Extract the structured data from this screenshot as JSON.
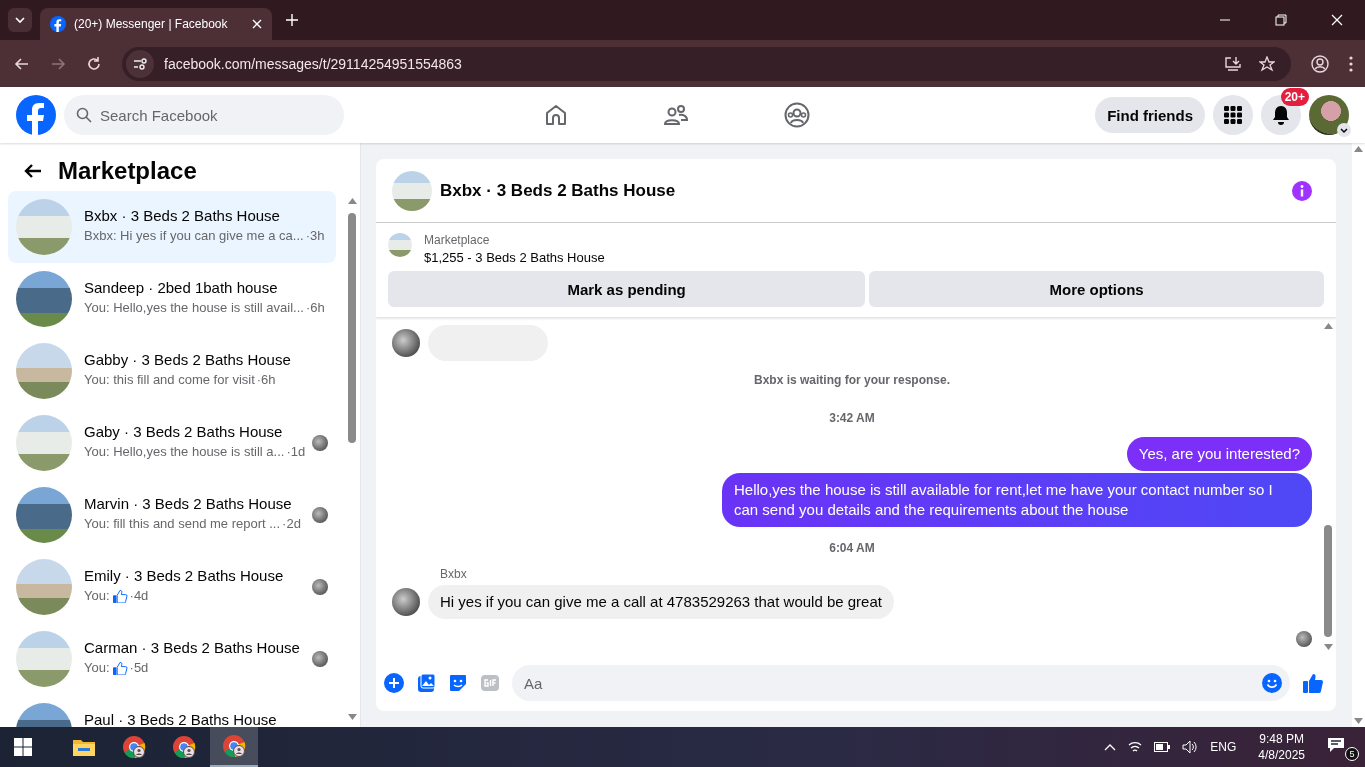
{
  "browser": {
    "tab_title": "(20+) Messenger | Facebook",
    "url": "facebook.com/messages/t/29114254951554863"
  },
  "header": {
    "search_placeholder": "Search Facebook",
    "find_friends": "Find friends",
    "notification_badge": "20+"
  },
  "sidebar": {
    "title": "Marketplace",
    "conversations": [
      {
        "title": "Bxbx · 3 Beds 2 Baths House",
        "kind": "text",
        "preview": "Bxbx: Hi yes if you can give me a ca...",
        "time": "·3h",
        "selected": true,
        "seen": false
      },
      {
        "title": "Sandeep · 2bed 1bath house",
        "kind": "text",
        "preview": "You: Hello,yes the house is still avail...",
        "time": "·6h",
        "selected": false,
        "seen": false
      },
      {
        "title": "Gabby · 3 Beds 2 Baths House",
        "kind": "text",
        "preview": "You: this fill and come for visit",
        "time": "·6h",
        "selected": false,
        "seen": false
      },
      {
        "title": "Gaby · 3 Beds 2 Baths House",
        "kind": "text",
        "preview": "You: Hello,yes the house is still a...",
        "time": "·1d",
        "selected": false,
        "seen": true
      },
      {
        "title": "Marvin · 3 Beds 2 Baths House",
        "kind": "text",
        "preview": "You: fill this and send me report ...",
        "time": "·2d",
        "selected": false,
        "seen": true
      },
      {
        "title": "Emily · 3 Beds 2 Baths House",
        "kind": "like",
        "preview": "You:",
        "time": "·4d",
        "selected": false,
        "seen": true
      },
      {
        "title": "Carman · 3 Beds 2 Baths House",
        "kind": "like",
        "preview": "You:",
        "time": "·5d",
        "selected": false,
        "seen": true
      },
      {
        "title": "Paul · 3 Beds 2 Baths House",
        "kind": "text",
        "selected": false,
        "seen": false
      }
    ]
  },
  "chat": {
    "title": "Bxbx · 3 Beds 2 Baths House",
    "listing_label": "Marketplace",
    "listing_title": "$1,255 - 3 Beds 2 Baths House",
    "actions": [
      "Mark as pending",
      "More options"
    ],
    "messages": [
      {
        "kind": "received_cut"
      },
      {
        "kind": "notice",
        "text": "Bxbx is waiting for your response."
      },
      {
        "kind": "time",
        "text": "3:42 AM"
      },
      {
        "kind": "sent",
        "text": "Yes, are you interested?"
      },
      {
        "kind": "sent",
        "text": "Hello,yes the house is still available for rent,let me have your contact number so I can send you details and the requirements about the house"
      },
      {
        "kind": "time",
        "text": "6:04 AM"
      },
      {
        "kind": "sender",
        "text": "Bxbx"
      },
      {
        "kind": "received",
        "text": "Hi yes if you can give me a call at 4783529263 that would be great"
      },
      {
        "kind": "seen"
      }
    ],
    "composer_placeholder": "Aa"
  },
  "taskbar": {
    "apps": [
      {
        "kind": "folder",
        "selected": false
      },
      {
        "kind": "browser",
        "selected": false
      },
      {
        "kind": "browser",
        "selected": false
      },
      {
        "kind": "browser",
        "selected": true
      }
    ],
    "language": "ENG",
    "time": "9:48 PM",
    "date": "4/8/2025",
    "notifications": "5"
  }
}
